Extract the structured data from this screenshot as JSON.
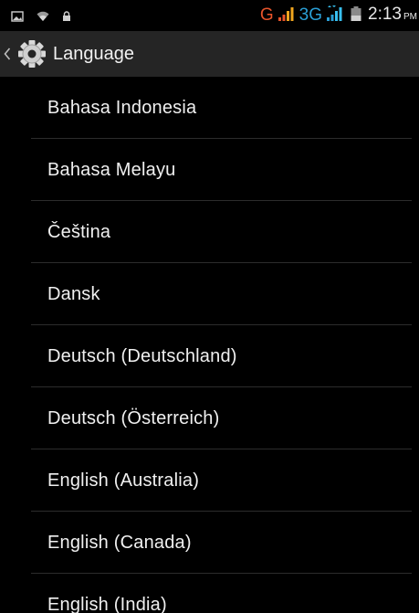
{
  "status_bar": {
    "carrier": "G",
    "network": "3G",
    "time": "2:13",
    "ampm": "PM",
    "icons": [
      "screenshot-icon",
      "wifi-icon",
      "lock-icon",
      "signal-icon",
      "battery-icon"
    ],
    "carrier_color": "#e8542a",
    "network_color": "#2a9fd6"
  },
  "action_bar": {
    "title": "Language",
    "icon": "settings-gear-icon"
  },
  "languages": [
    "Bahasa Indonesia",
    "Bahasa Melayu",
    "Čeština",
    "Dansk",
    "Deutsch (Deutschland)",
    "Deutsch (Österreich)",
    "English (Australia)",
    "English (Canada)",
    "English (India)"
  ]
}
